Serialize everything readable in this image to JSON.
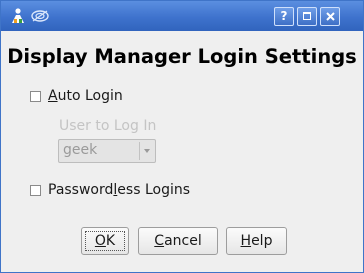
{
  "window": {
    "title_bar_buttons": {
      "help": "?"
    },
    "icons": {
      "app": "kde-app-icon",
      "menu": "window-menu-icon",
      "maximize": "maximize-icon",
      "close": "close-icon"
    }
  },
  "dialog": {
    "heading": "Display Manager Login Settings",
    "auto_login": {
      "label_underlined": "A",
      "label_rest": "uto Login",
      "checked": false
    },
    "user_to_log_in": {
      "label": "User to Log In",
      "selected_value": "geek",
      "enabled": false
    },
    "passwordless": {
      "label_before": "Password",
      "label_underlined": "l",
      "label_after": "ess Logins",
      "checked": false
    }
  },
  "buttons": {
    "ok": {
      "underlined": "O",
      "rest": "K"
    },
    "cancel": {
      "underlined": "C",
      "rest": "ancel"
    },
    "help": {
      "underlined": "H",
      "rest": "elp"
    }
  },
  "colors": {
    "titlebar": "#3e72cd",
    "dialog_background": "#efefef",
    "disabled_text": "#c4c4c4"
  }
}
